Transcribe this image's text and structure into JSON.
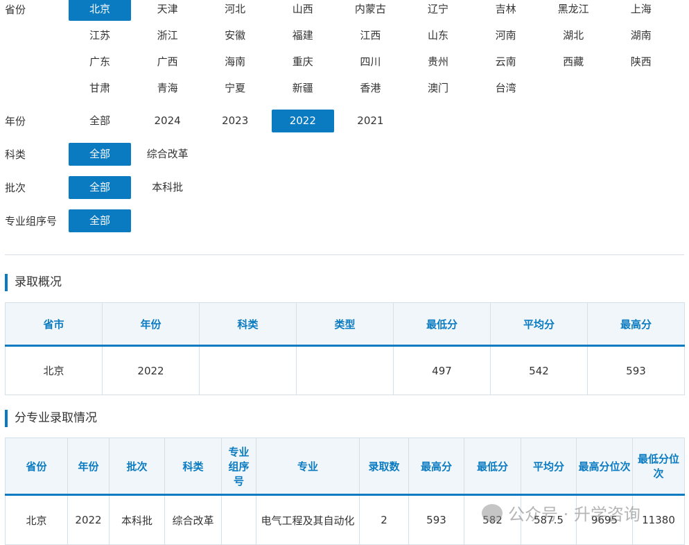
{
  "filters": {
    "province": {
      "label": "省份",
      "options": [
        "北京",
        "天津",
        "河北",
        "山西",
        "内蒙古",
        "辽宁",
        "吉林",
        "黑龙江",
        "上海",
        "江苏",
        "浙江",
        "安徽",
        "福建",
        "江西",
        "山东",
        "河南",
        "湖北",
        "湖南",
        "广东",
        "广西",
        "海南",
        "重庆",
        "四川",
        "贵州",
        "云南",
        "西藏",
        "陕西",
        "甘肃",
        "青海",
        "宁夏",
        "新疆",
        "香港",
        "澳门",
        "台湾"
      ],
      "selected": "北京"
    },
    "year": {
      "label": "年份",
      "options": [
        "全部",
        "2024",
        "2023",
        "2022",
        "2021"
      ],
      "selected": "2022"
    },
    "category": {
      "label": "科类",
      "options": [
        "全部",
        "综合改革"
      ],
      "selected": "全部"
    },
    "batch": {
      "label": "批次",
      "options": [
        "全部",
        "本科批"
      ],
      "selected": "全部"
    },
    "group": {
      "label": "专业组序号",
      "options": [
        "全部"
      ],
      "selected": "全部"
    }
  },
  "summary": {
    "title": "录取概况",
    "headers": [
      "省市",
      "年份",
      "科类",
      "类型",
      "最低分",
      "平均分",
      "最高分"
    ],
    "rows": [
      [
        "北京",
        "2022",
        "",
        "",
        "497",
        "542",
        "593"
      ]
    ]
  },
  "major": {
    "title": "分专业录取情况",
    "headers": [
      "省份",
      "年份",
      "批次",
      "科类",
      "专业组序号",
      "专业",
      "录取数",
      "最高分",
      "最低分",
      "平均分",
      "最高分位次",
      "最低分位次"
    ],
    "rows": [
      [
        "北京",
        "2022",
        "本科批",
        "综合改革",
        "",
        "电气工程及其自动化",
        "2",
        "593",
        "582",
        "587.5",
        "9695",
        "11380"
      ]
    ]
  },
  "watermark": "公众号 · 升学咨询",
  "colors": {
    "accent": "#0b7bc1"
  }
}
